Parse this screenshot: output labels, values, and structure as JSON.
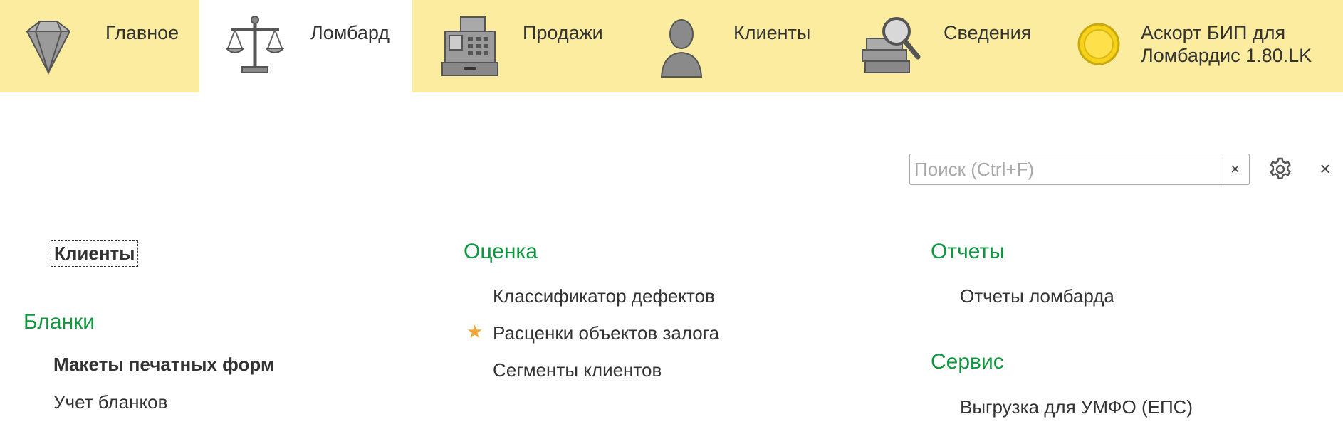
{
  "top_panel": {
    "tabs": [
      {
        "label": "Главное",
        "icon": "diamond-icon",
        "active": false
      },
      {
        "label": "Ломбард",
        "icon": "scales-icon",
        "active": true
      },
      {
        "label": "Продажи",
        "icon": "cash-register-icon",
        "active": false
      },
      {
        "label": "Клиенты",
        "icon": "person-icon",
        "active": false
      },
      {
        "label": "Сведения",
        "icon": "books-magnifier-icon",
        "active": false
      },
      {
        "label_line1": "Аскорт БИП для",
        "label_line2": "Ломбардис 1.80.LK",
        "icon": "coin-icon",
        "active": false
      }
    ],
    "bg_color": "#fbeca0"
  },
  "search": {
    "placeholder": "Поиск (Ctrl+F)",
    "value": "",
    "clear_label": "×"
  },
  "window": {
    "close_label": "×"
  },
  "sections": {
    "col1": {
      "clients_link": "Клиенты",
      "blanks_heading": "Бланки",
      "print_templates": "Макеты печатных форм",
      "blanks_accounting": "Учет бланков"
    },
    "col2": {
      "evaluation_heading": "Оценка",
      "defects_classifier": "Классификатор дефектов",
      "pledge_prices": "Расценки объектов залога",
      "client_segments": "Сегменты клиентов"
    },
    "col3": {
      "reports_heading": "Отчеты",
      "pawnshop_reports": "Отчеты ломбарда",
      "service_heading": "Сервис",
      "umfo_export": "Выгрузка для УМФО (ЕПС)"
    }
  },
  "colors": {
    "heading": "#10963e",
    "star": "#f2a634"
  }
}
